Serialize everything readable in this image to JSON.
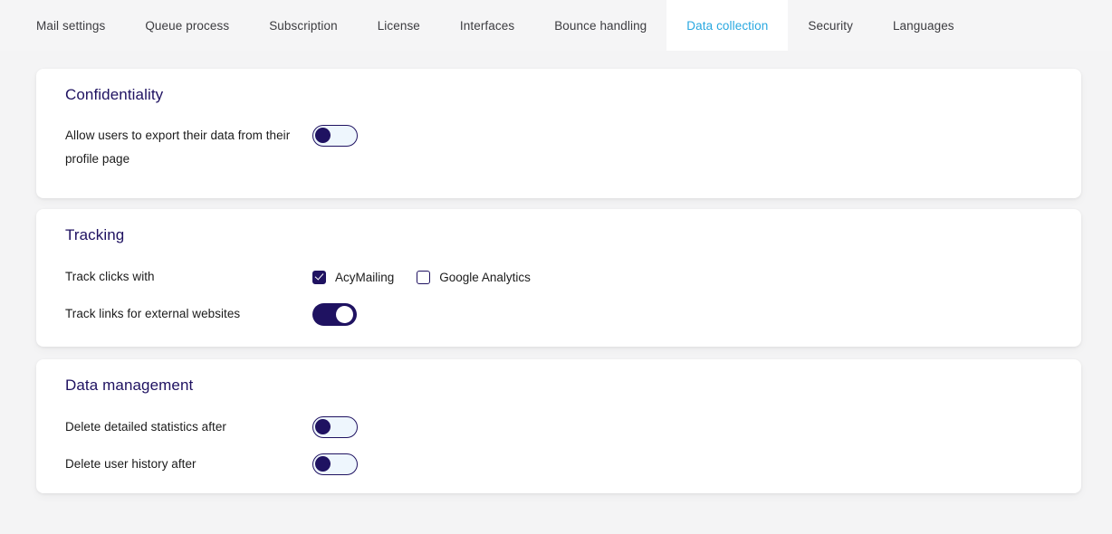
{
  "tabs": [
    {
      "label": "Mail settings",
      "active": false
    },
    {
      "label": "Queue process",
      "active": false
    },
    {
      "label": "Subscription",
      "active": false
    },
    {
      "label": "License",
      "active": false
    },
    {
      "label": "Interfaces",
      "active": false
    },
    {
      "label": "Bounce handling",
      "active": false
    },
    {
      "label": "Data collection",
      "active": true
    },
    {
      "label": "Security",
      "active": false
    },
    {
      "label": "Languages",
      "active": false
    }
  ],
  "colors": {
    "page_background": "#f4f4f5",
    "tabbar_background": "#f5f5f6",
    "active_tab_text": "#29a8e0",
    "heading": "#1f1261",
    "body_text": "#1b1b1b",
    "toggle_on": "#1f1261",
    "toggle_off_track": "#eef6fd",
    "card_background": "#ffffff"
  },
  "confidentiality": {
    "title": "Confidentiality",
    "export_row": {
      "label": "Allow users to export their data from their profile page",
      "toggle_state": "off"
    }
  },
  "tracking": {
    "title": "Tracking",
    "track_clicks_row": {
      "label": "Track clicks with",
      "options": [
        {
          "label": "AcyMailing",
          "checked": true
        },
        {
          "label": "Google Analytics",
          "checked": false
        }
      ]
    },
    "track_links_row": {
      "label": "Track links for external websites",
      "toggle_state": "on"
    }
  },
  "data_management": {
    "title": "Data management",
    "delete_stats_row": {
      "label": "Delete detailed statistics after",
      "toggle_state": "off"
    },
    "delete_history_row": {
      "label": "Delete user history after",
      "toggle_state": "off"
    }
  }
}
